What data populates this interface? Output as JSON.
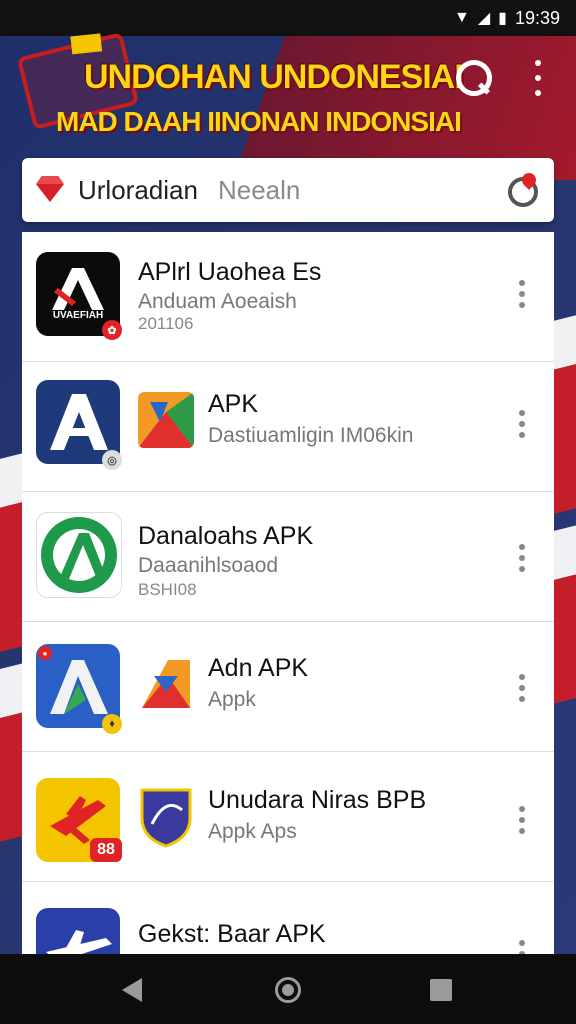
{
  "status": {
    "time": "19:39"
  },
  "header": {
    "title_line1": "UNDOHAN UNDONESIAI",
    "title_line2": "MAD DAAH IINONAN INDONSIAI"
  },
  "search": {
    "query": "Urloradian",
    "placeholder": "Neealn"
  },
  "apps": [
    {
      "title": "APlrl Uaohea Es",
      "subtitle": "Anduam Aoeaish",
      "extra": "201106",
      "icon_text": "UVAEFIAH"
    },
    {
      "title": "APK",
      "subtitle": "Dastiuamligin IM06kin",
      "extra": ""
    },
    {
      "title": "Danaloahs APK",
      "subtitle": "Daaanihlsoaod",
      "extra": "BSHI08"
    },
    {
      "title": "Adn APK",
      "subtitle": "Appk",
      "extra": ""
    },
    {
      "title": "Unudara Niras BPB",
      "subtitle": "Appk Aps",
      "extra": "",
      "badge": "88"
    },
    {
      "title": "Gekst: Baar APK",
      "subtitle": "",
      "extra": ""
    }
  ],
  "colors": {
    "accent_red": "#c41e2a",
    "navy": "#1e2f6b",
    "title_yellow": "#f7d716"
  }
}
